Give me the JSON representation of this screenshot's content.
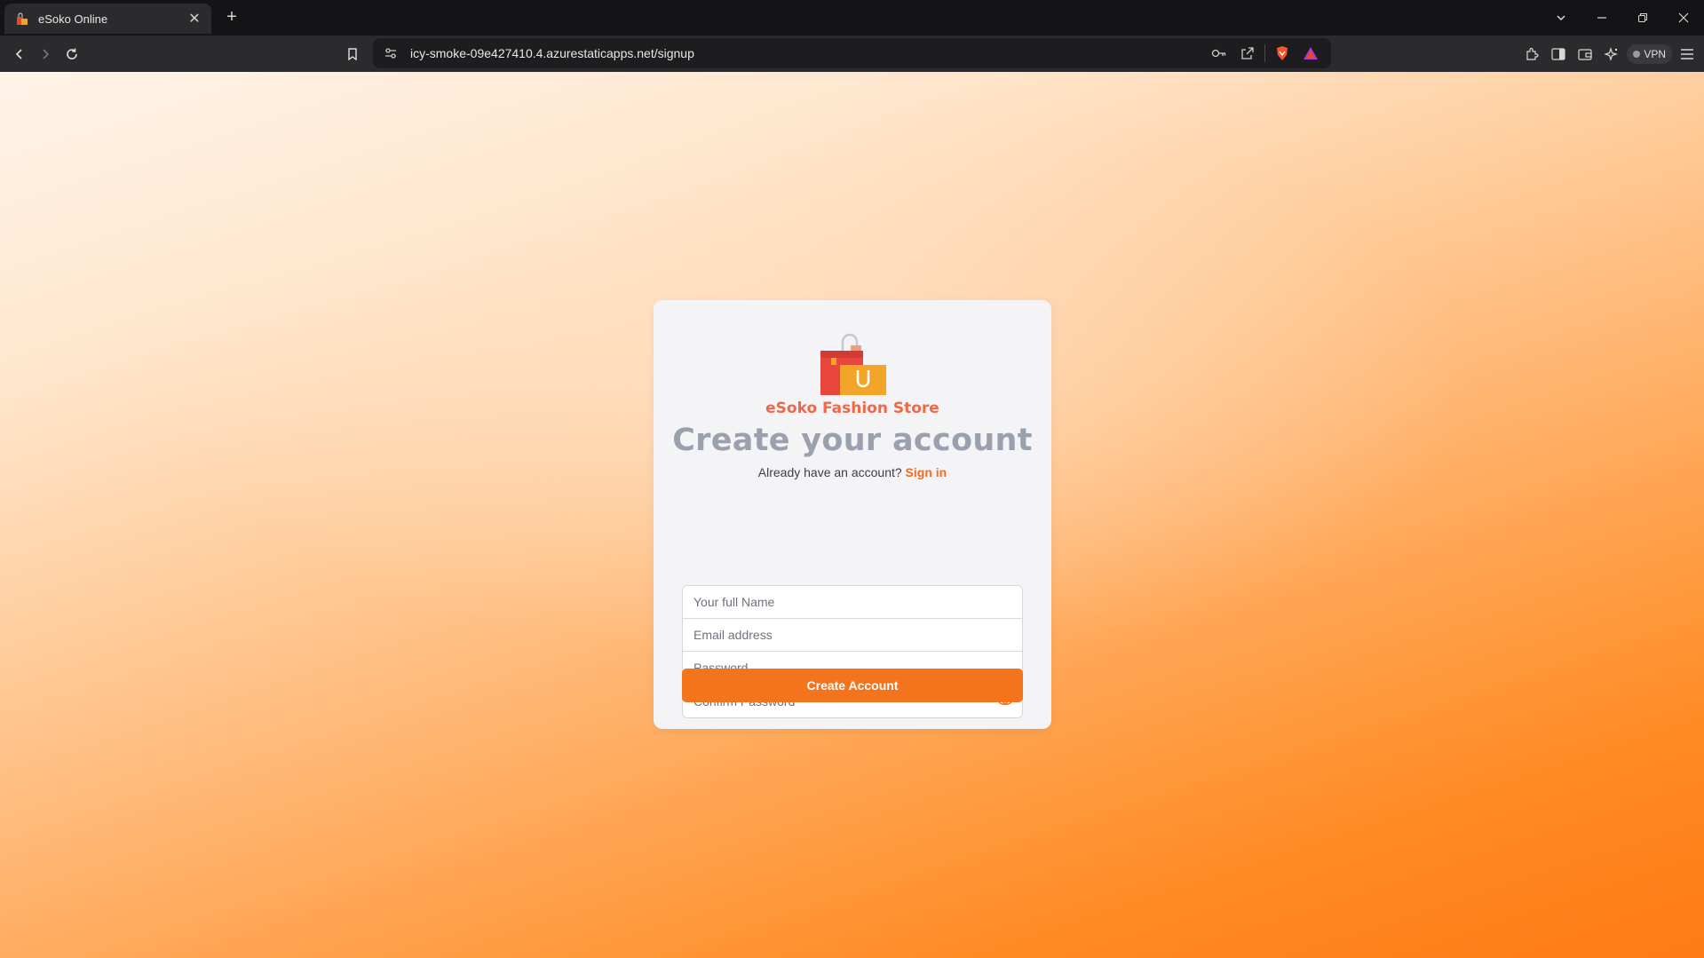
{
  "browser": {
    "tab_title": "eSoko Online",
    "url": "icy-smoke-09e427410.4.azurestaticapps.net/signup",
    "vpn_label": "VPN"
  },
  "page": {
    "brand_name": "eSoko Fashion Store",
    "heading": "Create your account",
    "have_account_text": "Already have an account?",
    "signin_link": "Sign in",
    "fields": {
      "full_name_placeholder": "Your full Name",
      "email_placeholder": "Email address",
      "password_placeholder": "Password",
      "confirm_password_placeholder": "Confirm Password"
    },
    "submit_label": "Create Account"
  },
  "colors": {
    "accent": "#f4741e",
    "brand_text": "#f0674a",
    "heading_text": "#9aa0ad"
  }
}
